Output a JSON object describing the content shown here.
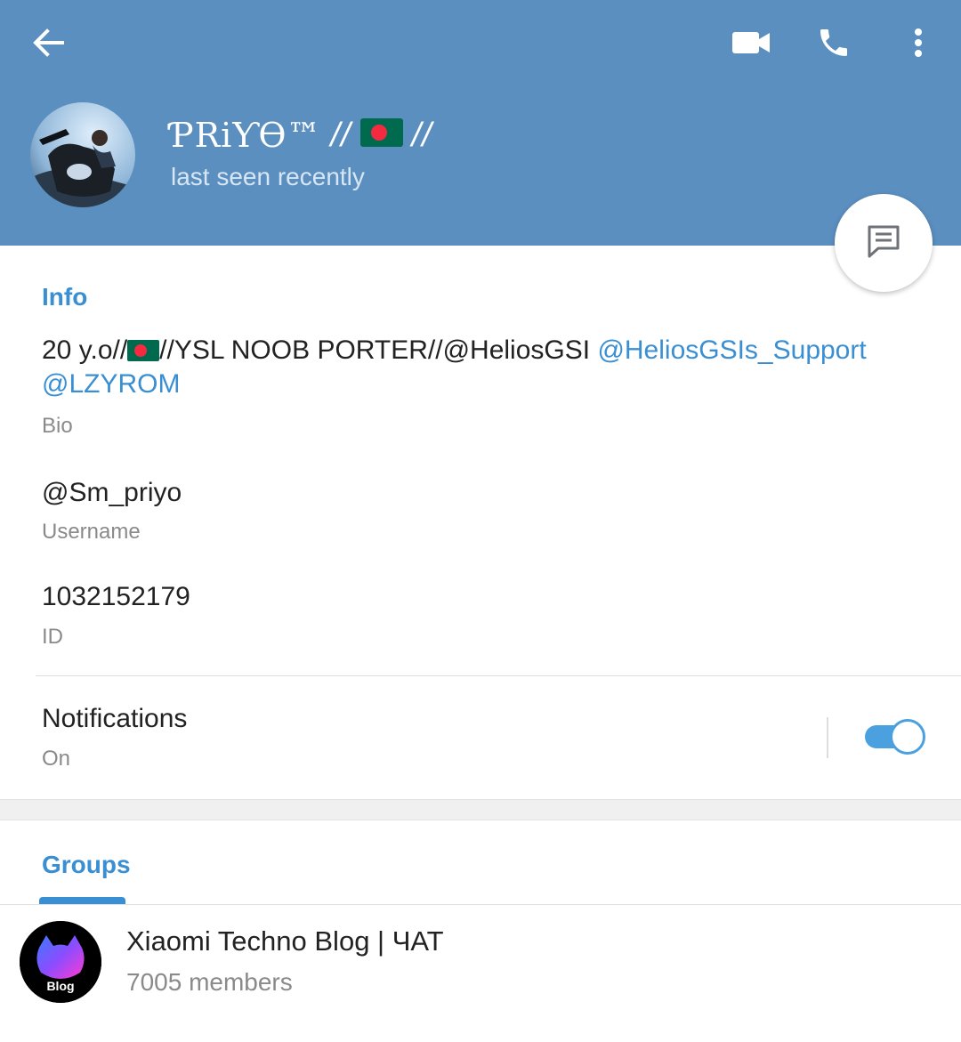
{
  "header": {
    "name": "ƤRiƳϴ™",
    "separator": "//",
    "flag": "🇧🇩",
    "status": "last seen recently",
    "color": "#5b8fc0"
  },
  "toolbar": {
    "back_icon": "arrow-left-icon",
    "video_icon": "video-camera-icon",
    "call_icon": "phone-icon",
    "more_icon": "more-vertical-icon"
  },
  "fab": {
    "icon": "message-icon"
  },
  "info": {
    "title": "Info",
    "bio": {
      "prefix": "20 y.o//",
      "flag": "🇧🇩",
      "middle": "//YSL NOOB PORTER//@HeliosGSI",
      "link1": "@HeliosGSIs_Support",
      "link2": "@LZYROM",
      "label": "Bio"
    },
    "username": {
      "value": "@Sm_priyo",
      "label": "Username"
    },
    "id": {
      "value": "1032152179",
      "label": "ID"
    }
  },
  "notifications": {
    "label": "Notifications",
    "state": "On",
    "enabled": true
  },
  "groups": {
    "tab": "Groups",
    "items": [
      {
        "name": "Xiaomi Techno Blog | ЧАТ",
        "members": "7005 members",
        "avatar_text": "Blog"
      }
    ]
  },
  "colors": {
    "accent": "#3a8fd3",
    "toggle": "#4ba1df",
    "flag_green": "#006a4e",
    "flag_red": "#f42a41"
  }
}
